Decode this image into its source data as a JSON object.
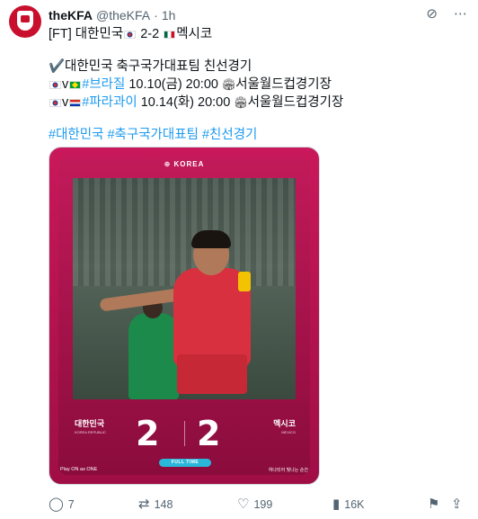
{
  "author": {
    "name": "theKFA",
    "handle": "@theKFA",
    "separator": "·",
    "time": "1h"
  },
  "tweet": {
    "line1_prefix": "[FT] 대한민국",
    "line1_score": "2-2",
    "line1_suffix": "멕시코",
    "line2": "✔️대한민국 축구국가대표팀 친선경기",
    "line3_v": "v",
    "line3_tag": "#브라질",
    "line3_date": " 10.10(금) 20:00 ",
    "line3_venue": "서울월드컵경기장",
    "line4_v": "v",
    "line4_tag": "#파라과이",
    "line4_date": " 10.14(화) 20:00 ",
    "line4_venue": "서울월드컵경기장",
    "hashtags": [
      "#대한민국",
      "#축구국가대표팀",
      "#친선경기"
    ]
  },
  "media": {
    "logo": "KOREA",
    "home_team": "대한민국",
    "home_team_sub": "KOREA REPUBLIC",
    "away_team": "멕시코",
    "away_team_sub": "MEXICO",
    "home_score": "2",
    "away_score": "2",
    "status": "FULL TIME",
    "slogan_left": "Play ON as ONE",
    "slogan_right": "하나되어 빛나는 순간"
  },
  "actions": {
    "replies": "7",
    "retweets": "148",
    "likes": "199",
    "views": "16K"
  },
  "icons": {
    "grok": "grok-icon",
    "more": "more-icon",
    "reply": "reply-icon",
    "retweet": "retweet-icon",
    "like": "heart-icon",
    "views": "views-icon",
    "bookmark": "bookmark-icon",
    "share": "share-icon"
  },
  "colors": {
    "link": "#1d9bf0",
    "muted": "#536471",
    "card": "#c9185b"
  }
}
